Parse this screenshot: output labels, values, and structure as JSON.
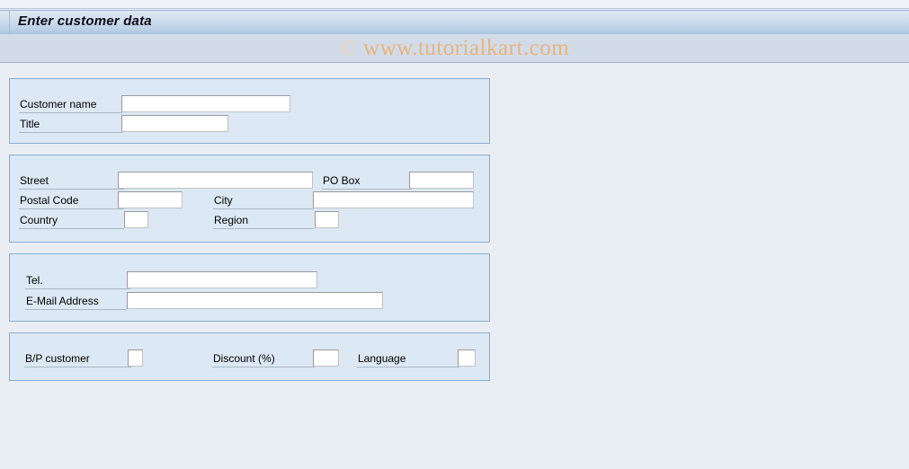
{
  "window": {
    "title": "Enter customer data",
    "watermark_copyright": "©",
    "watermark": "www.tutorialkart.com"
  },
  "colors": {
    "title_bar_top": "#dfe9f4",
    "title_bar_bottom": "#a9c2dd",
    "watermark_strip": "#d2dce8",
    "watermark_text": "#eab27c",
    "panel_fill": "#dce8f3",
    "panel_border": "#8aaed0",
    "canvas": "#e9eef5",
    "input_fill": "#ffffff",
    "label_underline": "#a9b7c6"
  },
  "groups": [
    {
      "name": "customer",
      "fields": [
        {
          "label": "Customer name",
          "value": "",
          "placeholder": ""
        },
        {
          "label": "Title",
          "value": "",
          "placeholder": ""
        }
      ]
    },
    {
      "name": "address",
      "fields": [
        {
          "label": "Street",
          "value": "",
          "placeholder": ""
        },
        {
          "label": "PO Box",
          "value": "",
          "placeholder": ""
        },
        {
          "label": "Postal Code",
          "value": "",
          "placeholder": ""
        },
        {
          "label": "City",
          "value": "",
          "placeholder": ""
        },
        {
          "label": "Country",
          "value": "",
          "placeholder": ""
        },
        {
          "label": "Region",
          "value": "",
          "placeholder": ""
        }
      ]
    },
    {
      "name": "contact",
      "fields": [
        {
          "label": "Tel.",
          "value": "",
          "placeholder": ""
        },
        {
          "label": "E-Mail Address",
          "value": "",
          "placeholder": ""
        }
      ]
    },
    {
      "name": "commercial",
      "fields": [
        {
          "label": "B/P customer",
          "value": "",
          "placeholder": ""
        },
        {
          "label": "Discount (%)",
          "value": "",
          "placeholder": ""
        },
        {
          "label": "Language",
          "value": "",
          "placeholder": ""
        }
      ]
    }
  ]
}
